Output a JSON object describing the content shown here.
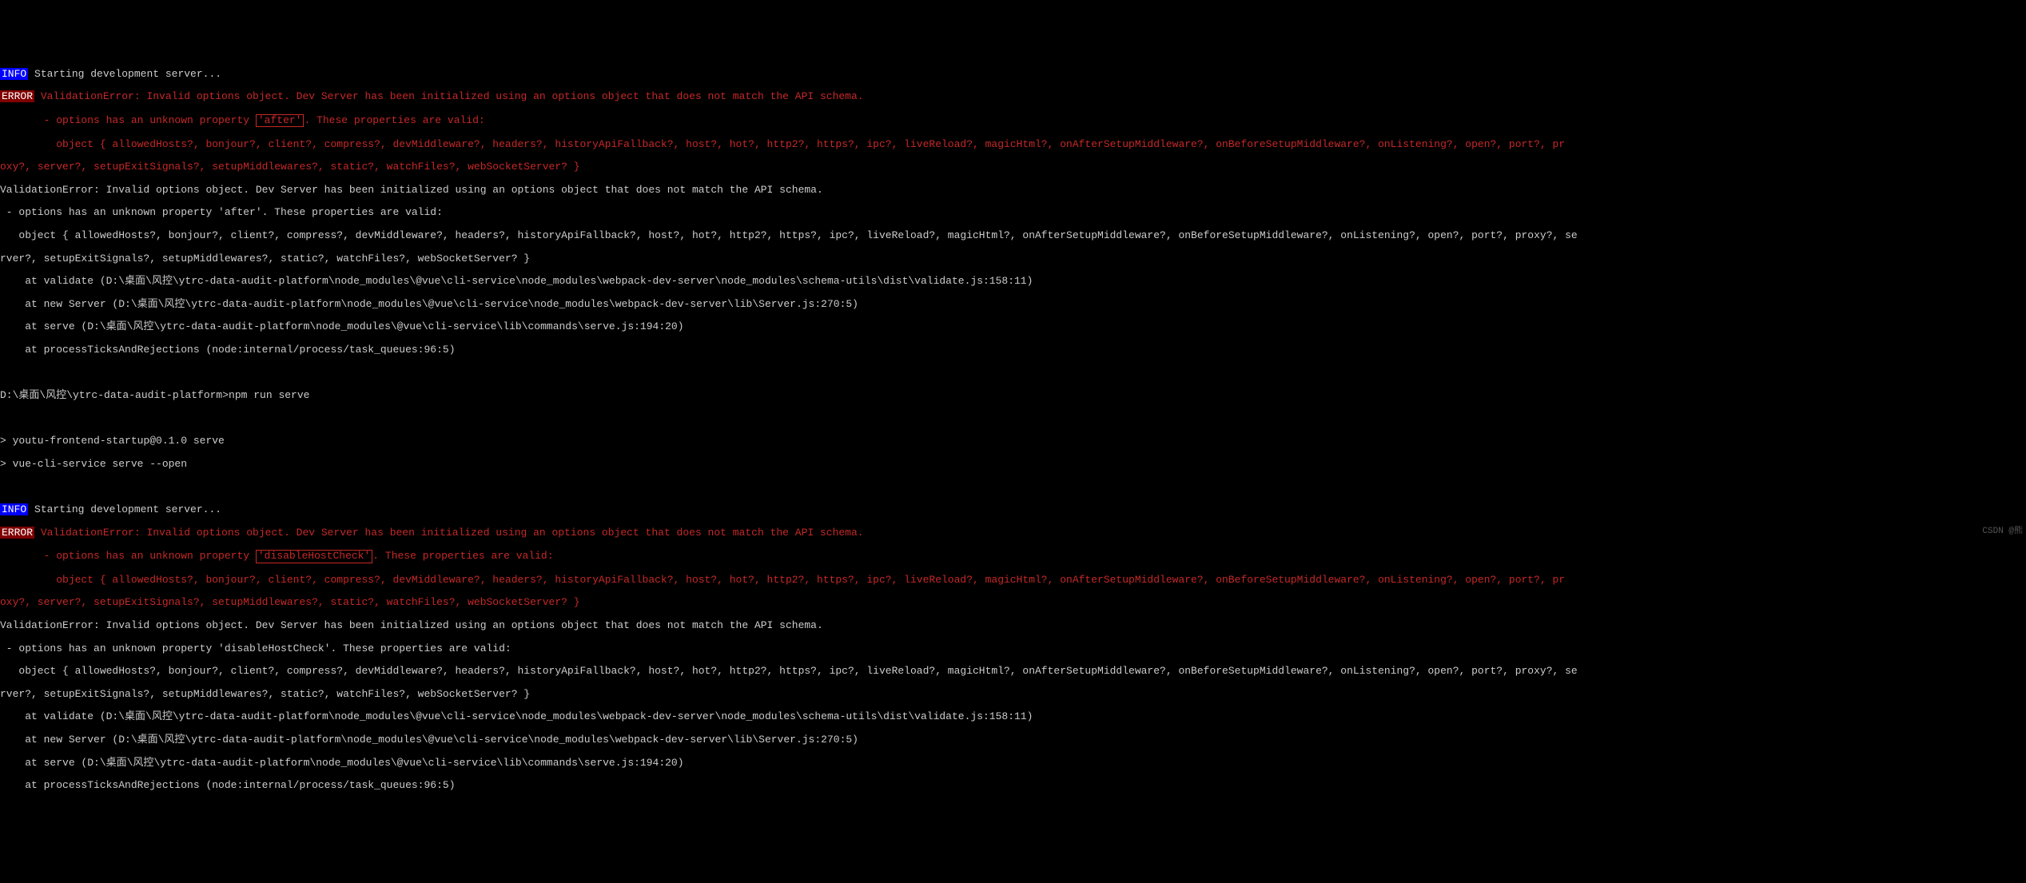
{
  "labels": {
    "info": "INFO",
    "error": "ERROR"
  },
  "watermark": "CSDN @熊",
  "pass1": {
    "info_line": " Starting development server...",
    "err_l1_a": " ValidationError: Invalid options object. Dev Server has been initialized using an options object that does not match the API schema.",
    "err_l2_a": "       - options has an unknown property ",
    "err_l2_box": "'after'",
    "err_l2_b": ". These properties are valid:",
    "err_l3": "         object { allowedHosts?, bonjour?, client?, compress?, devMiddleware?, headers?, historyApiFallback?, host?, hot?, http2?, https?, ipc?, liveReload?, magicHtml?, onAfterSetupMiddleware?, onBeforeSetupMiddleware?, onListening?, open?, port?, pr",
    "err_l4": "oxy?, server?, setupExitSignals?, setupMiddlewares?, static?, watchFiles?, webSocketServer? }",
    "stack": [
      "ValidationError: Invalid options object. Dev Server has been initialized using an options object that does not match the API schema.",
      " - options has an unknown property 'after'. These properties are valid:",
      "   object { allowedHosts?, bonjour?, client?, compress?, devMiddleware?, headers?, historyApiFallback?, host?, hot?, http2?, https?, ipc?, liveReload?, magicHtml?, onAfterSetupMiddleware?, onBeforeSetupMiddleware?, onListening?, open?, port?, proxy?, se",
      "rver?, setupExitSignals?, setupMiddlewares?, static?, watchFiles?, webSocketServer? }",
      "    at validate (D:\\桌面\\风控\\ytrc-data-audit-platform\\node_modules\\@vue\\cli-service\\node_modules\\webpack-dev-server\\node_modules\\schema-utils\\dist\\validate.js:158:11)",
      "    at new Server (D:\\桌面\\风控\\ytrc-data-audit-platform\\node_modules\\@vue\\cli-service\\node_modules\\webpack-dev-server\\lib\\Server.js:270:5)",
      "    at serve (D:\\桌面\\风控\\ytrc-data-audit-platform\\node_modules\\@vue\\cli-service\\lib\\commands\\serve.js:194:20)",
      "    at processTicksAndRejections (node:internal/process/task_queues:96:5)"
    ]
  },
  "cmd": {
    "prompt": "D:\\桌面\\风控\\ytrc-data-audit-platform>npm run serve",
    "blank": "",
    "l1": "> youtu-frontend-startup@0.1.0 serve",
    "l2": "> vue-cli-service serve --open"
  },
  "pass2": {
    "info_line": " Starting development server...",
    "err_l1_a": " ValidationError: Invalid options object. Dev Server has been initialized using an options object that does not match the API schema.",
    "err_l2_a": "       - options has an unknown property ",
    "err_l2_box": "'disableHostCheck'",
    "err_l2_b": ". These properties are valid:",
    "err_l3": "         object { allowedHosts?, bonjour?, client?, compress?, devMiddleware?, headers?, historyApiFallback?, host?, hot?, http2?, https?, ipc?, liveReload?, magicHtml?, onAfterSetupMiddleware?, onBeforeSetupMiddleware?, onListening?, open?, port?, pr",
    "err_l4": "oxy?, server?, setupExitSignals?, setupMiddlewares?, static?, watchFiles?, webSocketServer? }",
    "stack": [
      "ValidationError: Invalid options object. Dev Server has been initialized using an options object that does not match the API schema.",
      " - options has an unknown property 'disableHostCheck'. These properties are valid:",
      "   object { allowedHosts?, bonjour?, client?, compress?, devMiddleware?, headers?, historyApiFallback?, host?, hot?, http2?, https?, ipc?, liveReload?, magicHtml?, onAfterSetupMiddleware?, onBeforeSetupMiddleware?, onListening?, open?, port?, proxy?, se",
      "rver?, setupExitSignals?, setupMiddlewares?, static?, watchFiles?, webSocketServer? }",
      "    at validate (D:\\桌面\\风控\\ytrc-data-audit-platform\\node_modules\\@vue\\cli-service\\node_modules\\webpack-dev-server\\node_modules\\schema-utils\\dist\\validate.js:158:11)",
      "    at new Server (D:\\桌面\\风控\\ytrc-data-audit-platform\\node_modules\\@vue\\cli-service\\node_modules\\webpack-dev-server\\lib\\Server.js:270:5)",
      "    at serve (D:\\桌面\\风控\\ytrc-data-audit-platform\\node_modules\\@vue\\cli-service\\lib\\commands\\serve.js:194:20)",
      "    at processTicksAndRejections (node:internal/process/task_queues:96:5)"
    ]
  }
}
